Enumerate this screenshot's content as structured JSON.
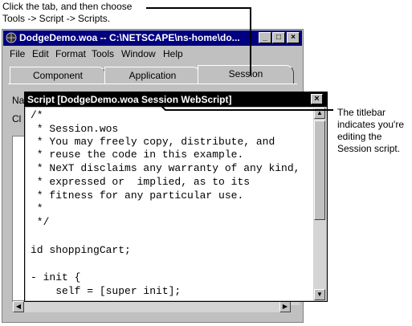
{
  "callouts": {
    "top_line1": "Click the tab, and then choose",
    "top_line2": "Tools -> Script -> Scripts.",
    "right_line1": "The titlebar",
    "right_line2": "indicates you're",
    "right_line3": "editing the",
    "right_line4": "Session script."
  },
  "main_window": {
    "title": "DodgeDemo.woa  -- C:\\NETSCAPE\\ns-home\\do...",
    "icon": "app-icon",
    "controls": {
      "minimize": "_",
      "maximize": "□",
      "close": "×"
    },
    "menu": [
      {
        "label": "File"
      },
      {
        "label": "Edit"
      },
      {
        "label": "Format"
      },
      {
        "label": "Tools"
      },
      {
        "label": "Window"
      },
      {
        "label": "Help"
      }
    ],
    "tabs": [
      {
        "label": "Component"
      },
      {
        "label": "Application"
      },
      {
        "label": "Session",
        "selected": true
      }
    ],
    "peek_label_1": "Na",
    "peek_label_2": "Cl"
  },
  "script_window": {
    "title": "Script [DodgeDemo.woa Session WebScript]",
    "close_label": "×",
    "code_lines": [
      "/*",
      " * Session.wos",
      " * You may freely copy, distribute, and",
      " * reuse the code in this example.",
      " * NeXT disclaims any warranty of any kind,",
      " * expressed or  implied, as to its",
      " * fitness for any particular use.",
      " *",
      " */",
      "",
      "id shoppingCart;",
      "",
      "- init {",
      "    self = [super init];"
    ]
  },
  "colors": {
    "main_titlebar": "#000080",
    "script_titlebar": "#000000",
    "chrome": "#c0c0c0"
  }
}
